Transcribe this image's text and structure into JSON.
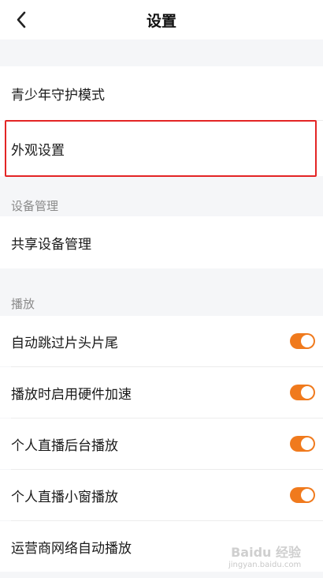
{
  "header": {
    "title": "设置"
  },
  "items": {
    "youth_mode": "青少年守护模式",
    "appearance": "外观设置"
  },
  "device_section": {
    "header": "设备管理",
    "item": "共享设备管理"
  },
  "playback_section": {
    "header": "播放",
    "items": [
      {
        "label": "自动跳过片头片尾",
        "toggle": true
      },
      {
        "label": "播放时启用硬件加速",
        "toggle": true
      },
      {
        "label": "个人直播后台播放",
        "toggle": true
      },
      {
        "label": "个人直播小窗播放",
        "toggle": true
      },
      {
        "label": "运营商网络自动播放"
      }
    ]
  },
  "colors": {
    "accent": "#f07a1d",
    "highlight": "#e32525"
  },
  "watermark": {
    "main": "Baidu 经验",
    "sub": "jingyan.baidu.com"
  }
}
